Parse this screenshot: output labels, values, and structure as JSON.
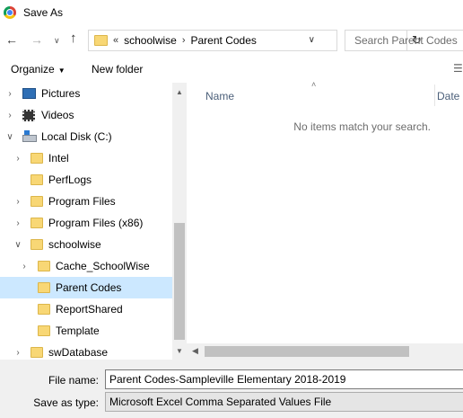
{
  "window": {
    "title": "Save As"
  },
  "address": {
    "overflow": "«",
    "crumbs": [
      "schoolwise",
      "Parent Codes"
    ],
    "separator": "›"
  },
  "search": {
    "placeholder": "Search Parent Codes"
  },
  "toolbar": {
    "organize_label": "Organize",
    "new_folder_label": "New folder"
  },
  "tree": {
    "items": [
      {
        "label": "Pictures",
        "icon": "pictures-icon",
        "expand": "collapsed",
        "level": 0
      },
      {
        "label": "Videos",
        "icon": "videos-icon",
        "expand": "collapsed",
        "level": 0
      },
      {
        "label": "Local Disk (C:)",
        "icon": "drive-icon",
        "expand": "expanded",
        "level": 0
      },
      {
        "label": "Intel",
        "icon": "folder-icon",
        "expand": "collapsed",
        "level": 1
      },
      {
        "label": "PerfLogs",
        "icon": "folder-icon",
        "expand": "none",
        "level": 1
      },
      {
        "label": "Program Files",
        "icon": "folder-icon",
        "expand": "collapsed",
        "level": 1
      },
      {
        "label": "Program Files (x86)",
        "icon": "folder-icon",
        "expand": "collapsed",
        "level": 1
      },
      {
        "label": "schoolwise",
        "icon": "folder-icon",
        "expand": "expanded",
        "level": 1
      },
      {
        "label": "Cache_SchoolWise",
        "icon": "folder-icon",
        "expand": "collapsed",
        "level": 2
      },
      {
        "label": "Parent Codes",
        "icon": "folder-icon",
        "expand": "none",
        "level": 2,
        "selected": true
      },
      {
        "label": "ReportShared",
        "icon": "folder-icon",
        "expand": "none",
        "level": 2
      },
      {
        "label": "Template",
        "icon": "folder-icon",
        "expand": "none",
        "level": 2
      },
      {
        "label": "swDatabase",
        "icon": "folder-icon",
        "expand": "collapsed",
        "level": 1
      }
    ]
  },
  "content": {
    "columns": {
      "name": "Name",
      "date": "Date m"
    },
    "empty_message": "No items match your search."
  },
  "form": {
    "file_name_label": "File name:",
    "file_name_value": "Parent Codes-Sampleville Elementary 2018-2019",
    "save_type_label": "Save as type:",
    "save_type_value": "Microsoft Excel Comma Separated Values File"
  },
  "colors": {
    "selection": "#cce8ff",
    "folder": "#f8d775",
    "header_text": "#4c607a"
  }
}
